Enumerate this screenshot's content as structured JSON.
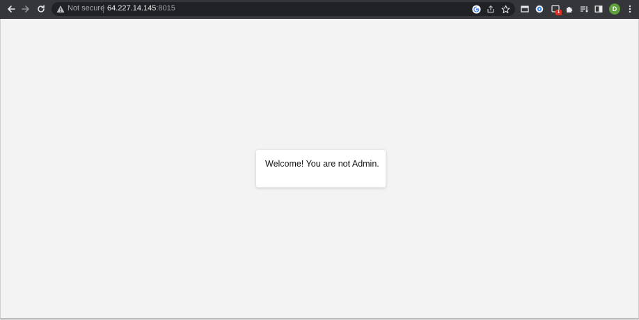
{
  "browser": {
    "security_label": "Not secure",
    "url_host": "64.227.14.145",
    "url_port": ":8015",
    "profile_initial": "D",
    "extension_badge": "1",
    "icons": [
      "back-arrow-icon",
      "forward-arrow-icon",
      "reload-icon",
      "warning-icon",
      "google-icon",
      "share-icon",
      "star-icon",
      "tab-search-icon",
      "extension-icon",
      "extension-badge-icon",
      "puzzle-icon",
      "reading-list-icon",
      "side-panel-icon",
      "kebab-menu-icon"
    ],
    "colors": {
      "toolbar": "#35363a",
      "omnibox": "#202124",
      "page_background": "#f3f3f3",
      "avatar": "#5f9f3e"
    }
  },
  "page": {
    "message": "Welcome! You are not Admin."
  }
}
